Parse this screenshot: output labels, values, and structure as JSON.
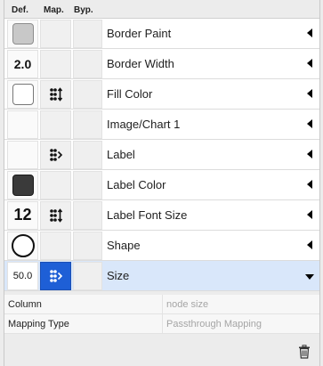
{
  "header": {
    "def": "Def.",
    "map": "Map.",
    "byp": "Byp."
  },
  "rows": [
    {
      "label": "Border Paint",
      "def_icon": "gray-swatch",
      "def_text": "",
      "map_icon": "",
      "selected": false
    },
    {
      "label": "Border Width",
      "def_icon": "",
      "def_text": "2.0",
      "map_icon": "",
      "selected": false
    },
    {
      "label": "Fill Color",
      "def_icon": "white-swatch",
      "def_text": "",
      "map_icon": "continuous-mapping-icon",
      "selected": false
    },
    {
      "label": "Image/Chart 1",
      "def_icon": "",
      "def_text": "",
      "map_icon": "",
      "selected": false
    },
    {
      "label": "Label",
      "def_icon": "",
      "def_text": "",
      "map_icon": "passthrough-mapping-icon",
      "selected": false
    },
    {
      "label": "Label Color",
      "def_icon": "dark-swatch",
      "def_text": "",
      "map_icon": "",
      "selected": false
    },
    {
      "label": "Label Font Size",
      "def_icon": "",
      "def_text": "12",
      "map_icon": "continuous-mapping-icon",
      "selected": false
    },
    {
      "label": "Shape",
      "def_icon": "ellipse-shape",
      "def_text": "",
      "map_icon": "",
      "selected": false
    },
    {
      "label": "Size",
      "def_icon": "",
      "def_text": "50.0",
      "map_icon": "passthrough-mapping-icon",
      "selected": true
    }
  ],
  "properties": [
    {
      "key": "Column",
      "value": "node size"
    },
    {
      "key": "Mapping Type",
      "value": "Passthrough Mapping"
    }
  ],
  "colors": {
    "selected_row": "#d9e7fa",
    "mapping_active": "#1e5fd6"
  }
}
